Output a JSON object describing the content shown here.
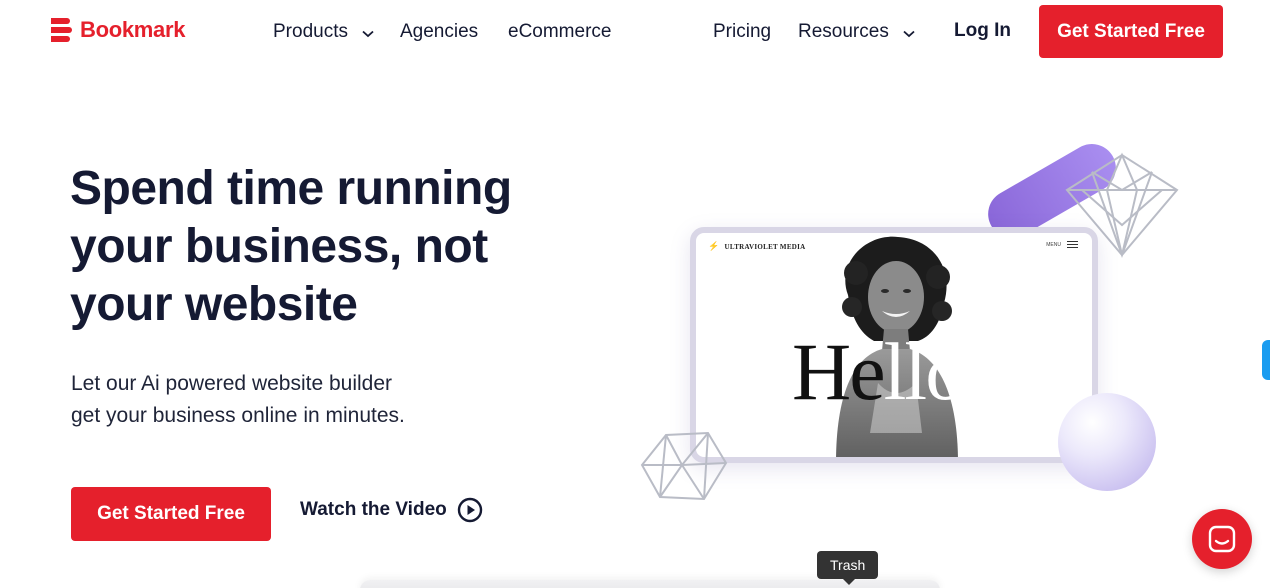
{
  "header": {
    "logo_text": "Bookmark",
    "nav": {
      "products": "Products",
      "agencies": "Agencies",
      "ecommerce": "eCommerce",
      "pricing": "Pricing",
      "resources": "Resources"
    },
    "login": "Log In",
    "cta": "Get Started Free"
  },
  "hero": {
    "title": "Spend time running your business, not your website",
    "subtitle_line1": "Let our Ai powered website builder",
    "subtitle_line2": "get your business online in minutes.",
    "cta": "Get Started Free",
    "watch_video": "Watch the Video"
  },
  "mockup": {
    "brand": "ULTRAVIOLET MEDIA",
    "menu": "MENU",
    "hello_dark": "He",
    "hello_light": "llo"
  },
  "tooltip": "Trash",
  "icons": {
    "logo": "bookmark-logo-icon",
    "dropdown": "chevron-down-icon",
    "play": "play-circle-icon",
    "chat": "chat-icon",
    "menu": "hamburger-icon"
  },
  "colors": {
    "brand_red": "#e5202c",
    "text_dark": "#151a33",
    "accent_purple": "#8a67d9",
    "side_tab_blue": "#1a9cf0"
  }
}
